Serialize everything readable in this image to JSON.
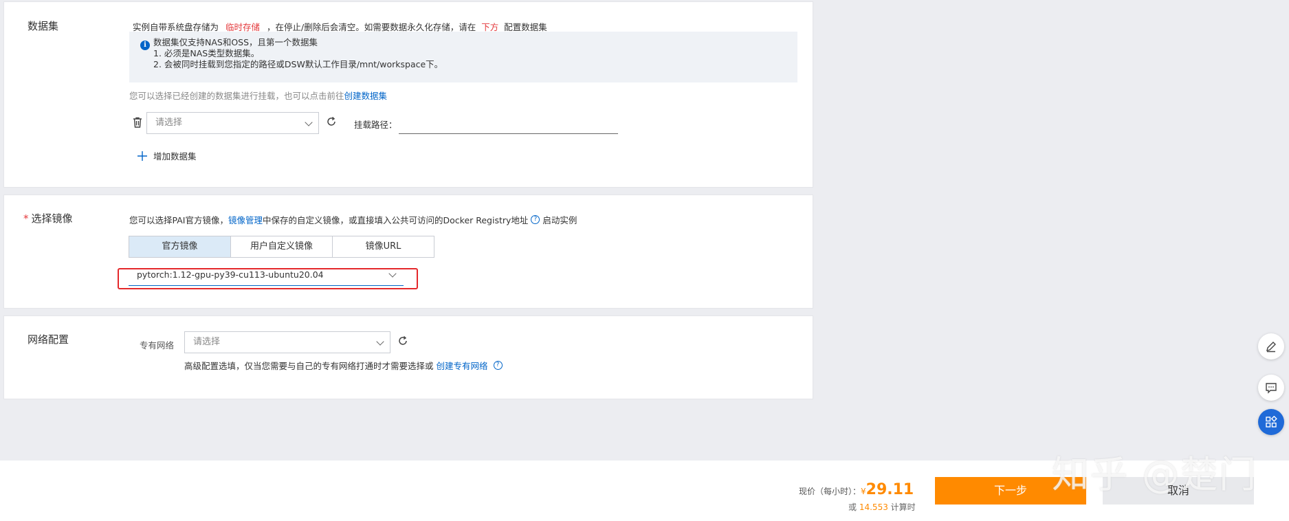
{
  "dataset": {
    "title": "数据集",
    "storage_text_before": "实例自带系统盘存储为",
    "storage_temp": "临时存储",
    "storage_text_mid": "，在停止/删除后会清空。如需要数据永久化存储，请在",
    "storage_below": "下方",
    "storage_text_after": "配置数据集",
    "info_lines": [
      "数据集仅支持NAS和OSS，且第一个数据集",
      "1. 必须是NAS类型数据集。",
      "2. 会被同时挂载到您指定的路径或DSW默认工作目录/mnt/workspace下。"
    ],
    "hint_text": "您可以选择已经创建的数据集进行挂载，也可以点击前往",
    "create_link": "创建数据集",
    "select_placeholder": "请选择",
    "mount_path_label": "挂载路径：",
    "add_dataset_label": "增加数据集"
  },
  "image": {
    "title": "选择镜像",
    "desc_before": "您可以选择PAI官方镜像，",
    "desc_link": "镜像管理",
    "desc_after": "中保存的自定义镜像，或直接填入公共可访问的Docker Registry地址",
    "desc_tail": "启动实例",
    "tabs": [
      "官方镜像",
      "用户自定义镜像",
      "镜像URL"
    ],
    "active_tab": 0,
    "selected_image": "pytorch:1.12-gpu-py39-cu113-ubuntu20.04"
  },
  "network": {
    "title": "网络配置",
    "vpc_label": "专有网络",
    "vpc_placeholder": "请选择",
    "hint_text": "高级配置选填，仅当您需要与自己的专有网络打通时才需要选择或",
    "hint_link": "创建专有网络"
  },
  "footer": {
    "price_label": "现价（每小时）：",
    "currency": "¥",
    "price": "29.11",
    "alt_prefix": "或",
    "alt_value": "14.553",
    "alt_suffix": "计算时",
    "next_label": "下一步",
    "cancel_label": "取消"
  },
  "watermark": "知乎 @楚门",
  "colors": {
    "accent": "#0064c8",
    "required": "#e4393c",
    "primary_button": "#ff8a00",
    "price": "#ff8a00",
    "highlight_box": "#e4272a"
  }
}
